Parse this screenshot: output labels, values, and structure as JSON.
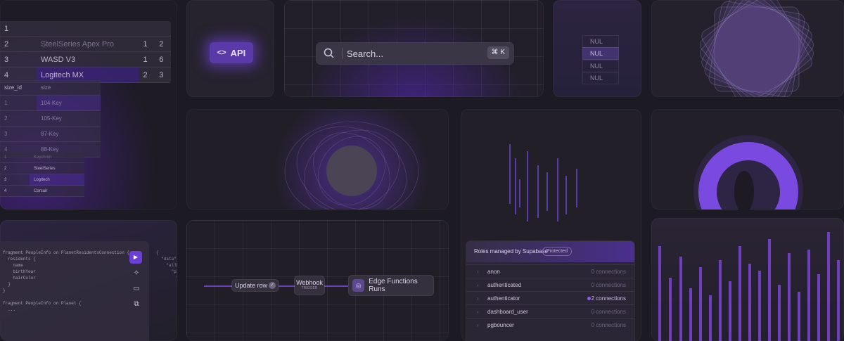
{
  "table_top": {
    "rows": [
      [
        "1",
        "",
        "",
        ""
      ],
      [
        "2",
        "SteelSeries Apex Pro",
        "1",
        "2"
      ],
      [
        "3",
        "WASD V3",
        "1",
        "6"
      ],
      [
        "4",
        "Logitech MX",
        "2",
        "3"
      ]
    ]
  },
  "table_sizes": {
    "header": [
      "size_id",
      "size"
    ],
    "rows": [
      [
        "1",
        "104-Key"
      ],
      [
        "2",
        "105-Key"
      ],
      [
        "3",
        "87-Key"
      ],
      [
        "4",
        "88-Key"
      ]
    ]
  },
  "table_brands": {
    "rows": [
      [
        "1",
        "Keychron"
      ],
      [
        "2",
        "SteelSeries"
      ],
      [
        "3",
        "Logitech"
      ],
      [
        "4",
        "Corsair"
      ]
    ]
  },
  "api_badge": {
    "label": "API",
    "icon": "code-brackets-icon"
  },
  "search": {
    "placeholder": "Search...",
    "shortcut": "⌘ K",
    "icon": "search-icon"
  },
  "nul_cells": [
    "NUL",
    "NUL",
    "NUL",
    "NUL"
  ],
  "graphql": {
    "code_left": "fragment PeopleInfo on PlanetResidentsConnection {\n  residents {\n    name\n    birthYear\n    hairColor\n  }\n}\n\nfragment PeopleInfo on Planet {\n  ...",
    "code_right": "{\n  \"data\": {\n    \"allPl\n      \"pla\n        \"plan\n          {"
  },
  "flow": {
    "node1": "Update row",
    "node2_title": "Webhook",
    "node2_sub": "TRIGGER",
    "node3": "Edge Functions Runs"
  },
  "roles": {
    "title": "Roles managed by Supabase",
    "badge": "Protected",
    "items": [
      {
        "name": "anon",
        "connections": "0 connections"
      },
      {
        "name": "authenticated",
        "connections": "0 connections"
      },
      {
        "name": "authenticator",
        "connections": "2 connections"
      },
      {
        "name": "dashboard_user",
        "connections": "0 connections"
      },
      {
        "name": "pgbouncer",
        "connections": "0 connections"
      }
    ]
  },
  "colors": {
    "accent": "#7a3ff0",
    "bg": "#1c1a22",
    "tile": "#211f27"
  }
}
